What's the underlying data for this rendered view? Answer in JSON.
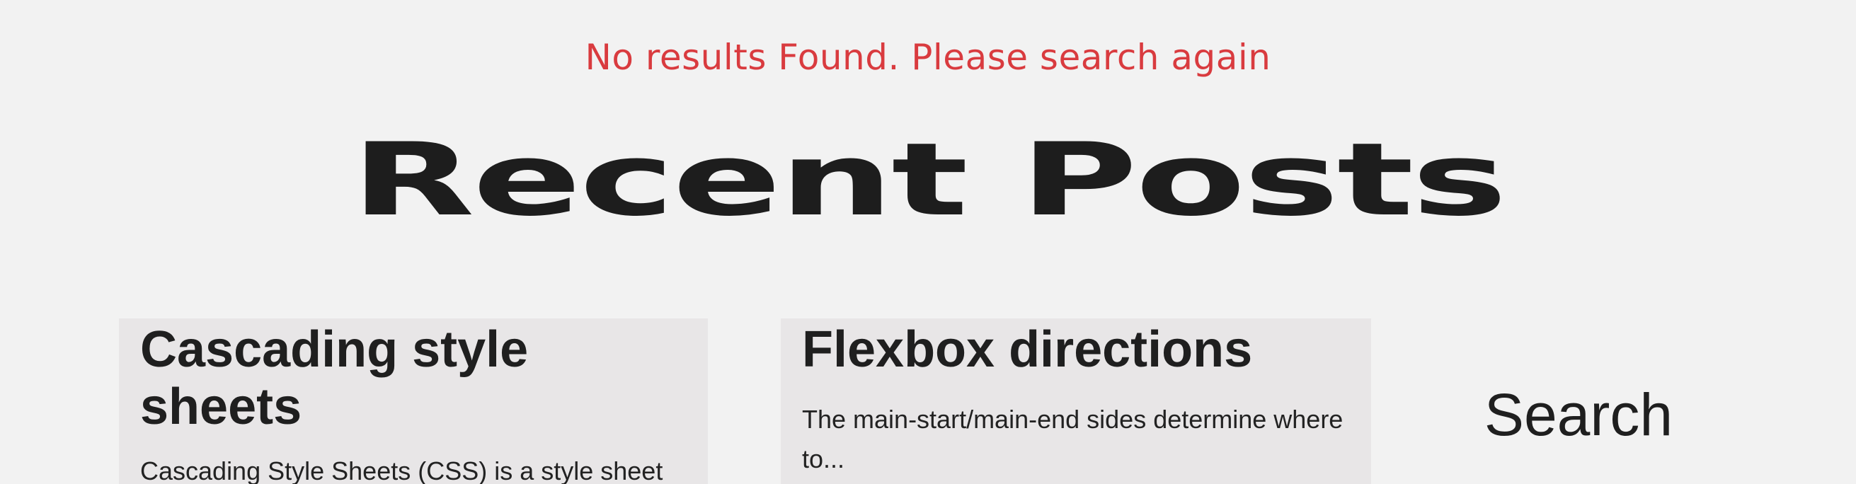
{
  "notice": {
    "text": "No results Found. Please search again",
    "color": "#d93b3f"
  },
  "recent_posts": {
    "heading": "Recent Posts",
    "posts": [
      {
        "title": "Cascading style sheets",
        "excerpt": "Cascading Style Sheets (CSS) is a style sheet"
      },
      {
        "title": "Flexbox directions",
        "excerpt": "The main-start/main-end sides determine where to..."
      }
    ]
  },
  "sidebar": {
    "search_heading": "Search"
  }
}
